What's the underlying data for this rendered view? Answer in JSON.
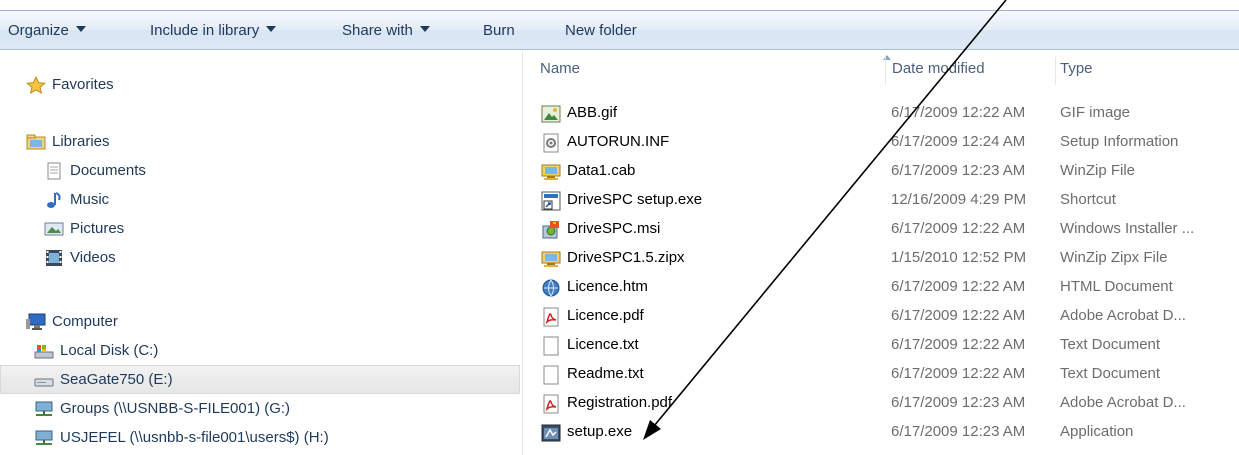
{
  "toolbar": {
    "organize": "Organize",
    "include_in_library": "Include in library",
    "share_with": "Share with",
    "burn": "Burn",
    "new_folder": "New folder"
  },
  "nav": {
    "favorites": "Favorites",
    "libraries": "Libraries",
    "documents": "Documents",
    "music": "Music",
    "pictures": "Pictures",
    "videos": "Videos",
    "computer": "Computer",
    "local_disk": "Local Disk (C:)",
    "seagate": "SeaGate750 (E:)",
    "groups": "Groups (\\\\USNBB-S-FILE001) (G:)",
    "usjefel": "USJEFEL (\\\\usnbb-s-file001\\users$) (H:)"
  },
  "columns": {
    "name": "Name",
    "date_modified": "Date modified",
    "type": "Type"
  },
  "files": [
    {
      "name": "ABB.gif",
      "date": "6/17/2009 12:22 AM",
      "type": "GIF image",
      "icon": "gif-image-icon"
    },
    {
      "name": "AUTORUN.INF",
      "date": "6/17/2009 12:24 AM",
      "type": "Setup Information",
      "icon": "setup-info-icon"
    },
    {
      "name": "Data1.cab",
      "date": "6/17/2009 12:23 AM",
      "type": "WinZip File",
      "icon": "winzip-icon"
    },
    {
      "name": "DriveSPC setup.exe",
      "date": "12/16/2009 4:29 PM",
      "type": "Shortcut",
      "icon": "shortcut-icon"
    },
    {
      "name": "DriveSPC.msi",
      "date": "6/17/2009 12:22 AM",
      "type": "Windows Installer ...",
      "icon": "installer-icon"
    },
    {
      "name": "DriveSPC1.5.zipx",
      "date": "1/15/2010 12:52 PM",
      "type": "WinZip Zipx File",
      "icon": "winzip-icon"
    },
    {
      "name": "Licence.htm",
      "date": "6/17/2009 12:22 AM",
      "type": "HTML Document",
      "icon": "html-document-icon"
    },
    {
      "name": "Licence.pdf",
      "date": "6/17/2009 12:22 AM",
      "type": "Adobe Acrobat D...",
      "icon": "pdf-icon"
    },
    {
      "name": "Licence.txt",
      "date": "6/17/2009 12:22 AM",
      "type": "Text Document",
      "icon": "text-document-icon"
    },
    {
      "name": "Readme.txt",
      "date": "6/17/2009 12:22 AM",
      "type": "Text Document",
      "icon": "text-document-icon"
    },
    {
      "name": "Registration.pdf",
      "date": "6/17/2009 12:23 AM",
      "type": "Adobe Acrobat D...",
      "icon": "pdf-icon"
    },
    {
      "name": "setup.exe",
      "date": "6/17/2009 12:23 AM",
      "type": "Application",
      "icon": "application-icon"
    }
  ],
  "colors": {
    "toolbar_text": "#1e395b",
    "nav_selected": "#e6e6e6",
    "arrow": "#000000"
  }
}
